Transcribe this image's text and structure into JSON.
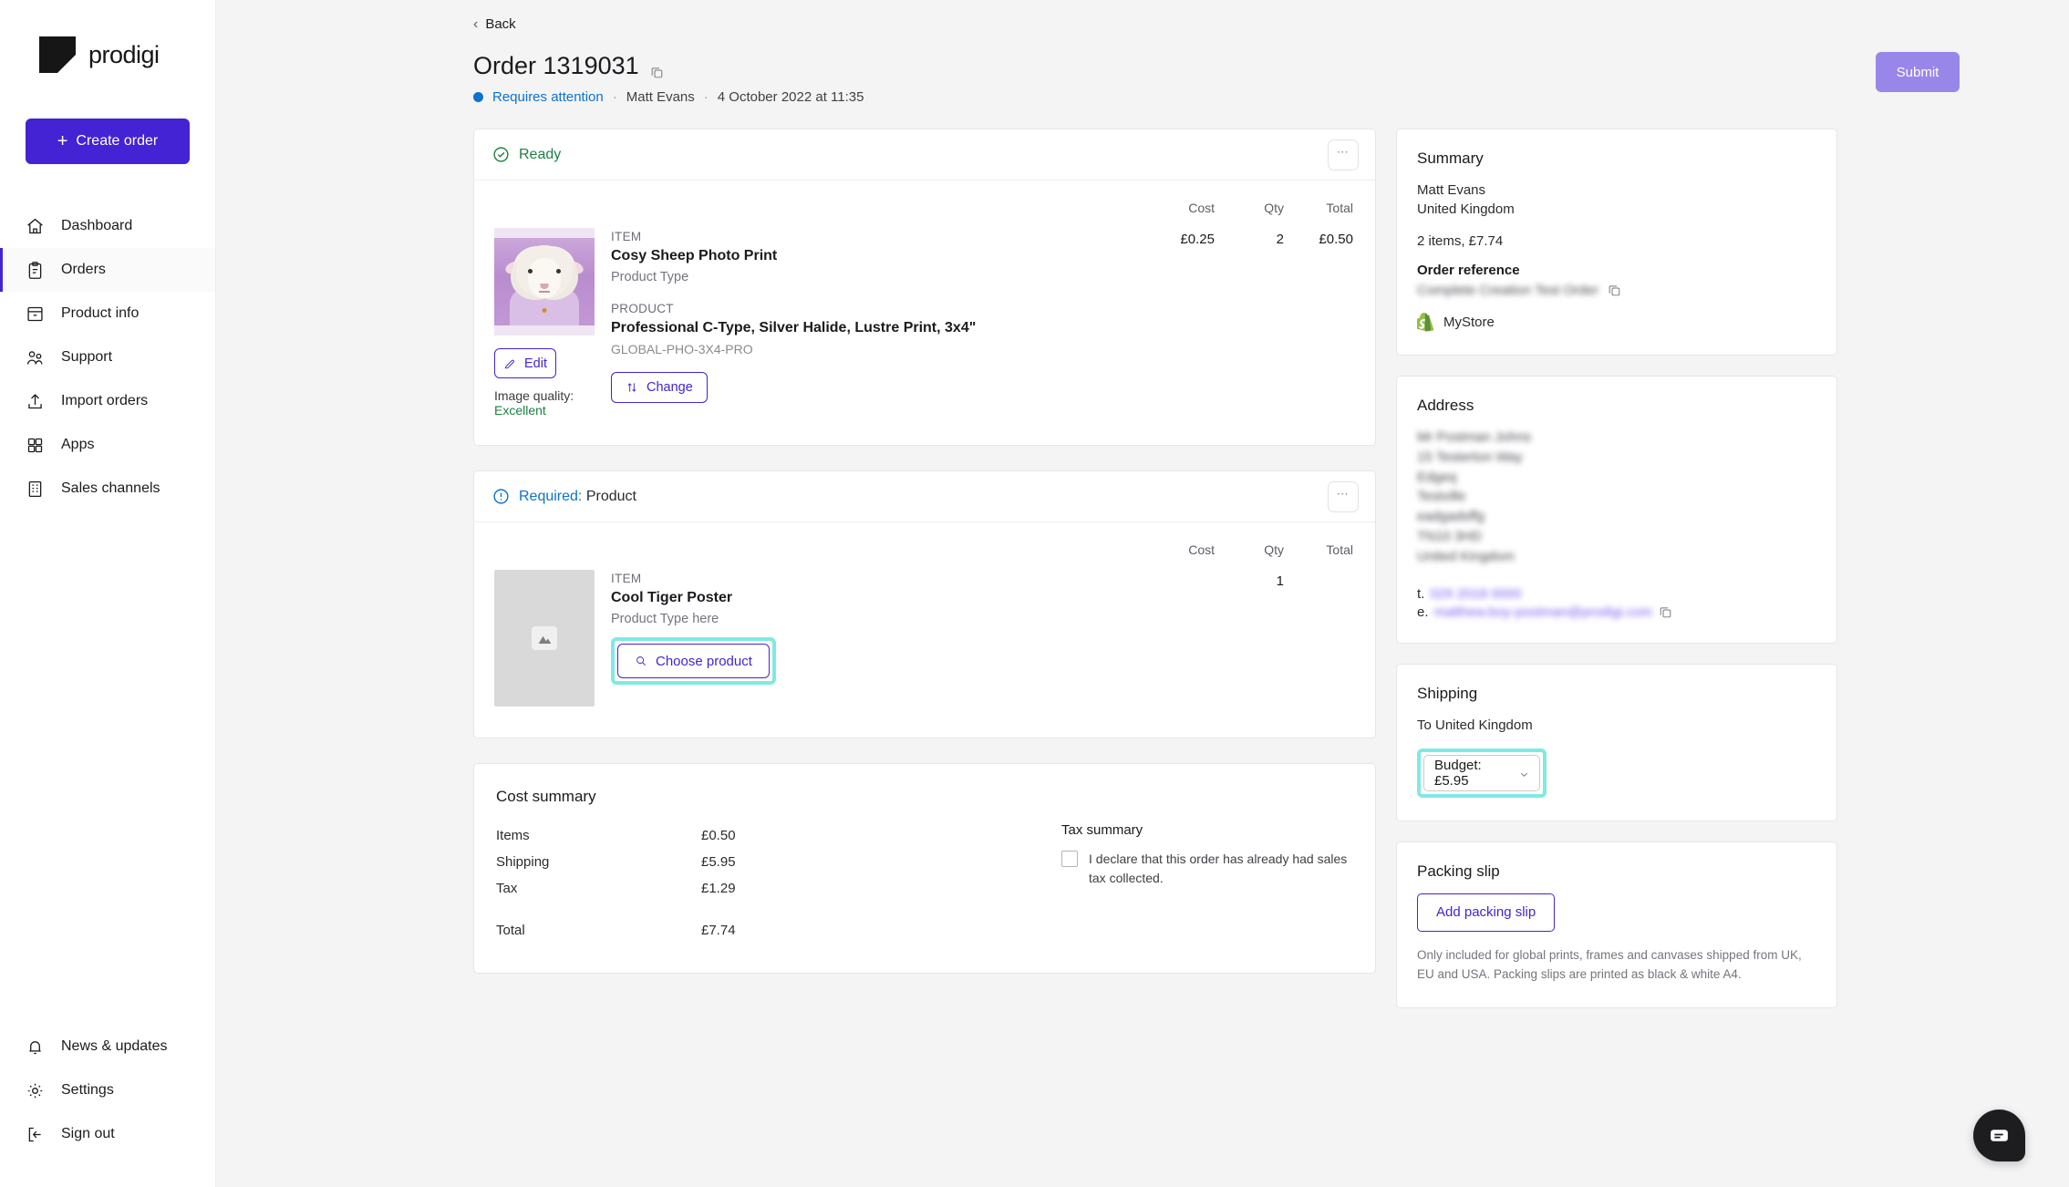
{
  "brand": {
    "name": "prodigi",
    "accent": "#4323d4"
  },
  "sidebar": {
    "create_order_label": "Create order",
    "items": [
      {
        "label": "Dashboard",
        "icon": "home-icon"
      },
      {
        "label": "Orders",
        "icon": "clipboard-icon"
      },
      {
        "label": "Product info",
        "icon": "archive-icon"
      },
      {
        "label": "Support",
        "icon": "users-icon"
      },
      {
        "label": "Import orders",
        "icon": "upload-icon"
      },
      {
        "label": "Apps",
        "icon": "grid-icon"
      },
      {
        "label": "Sales channels",
        "icon": "building-icon"
      }
    ],
    "bottom_items": [
      {
        "label": "News & updates",
        "icon": "bell-icon"
      },
      {
        "label": "Settings",
        "icon": "gear-icon"
      },
      {
        "label": "Sign out",
        "icon": "sign-out-icon"
      }
    ]
  },
  "header": {
    "back_label": "Back",
    "order_title": "Order 1319031",
    "status": "Requires attention",
    "status_color": "#0b72d0",
    "customer": "Matt Evans",
    "datetime": "4 October 2022 at 11:35",
    "separator": "·",
    "submit_label": "Submit"
  },
  "items_table": {
    "cost": "Cost",
    "qty": "Qty",
    "total": "Total"
  },
  "cards": [
    {
      "status_label": "Ready",
      "status_color": "#1e8140",
      "status_icon": "check-circle-icon",
      "item_label": "ITEM",
      "item_name": "Cosy Sheep Photo Print",
      "item_type": "Product Type",
      "product_label": "PRODUCT",
      "product_name": "Professional C-Type, Silver Halide, Lustre Print, 3x4\"",
      "sku": "GLOBAL-PHO-3X4-PRO",
      "cost": "£0.25",
      "qty": "2",
      "total": "£0.50",
      "edit_label": "Edit",
      "change_label": "Change",
      "image_quality_label": "Image quality:",
      "image_quality_value": "Excellent"
    },
    {
      "status_label_strong": "Required:",
      "status_label_rest": " Product",
      "status_color": "#0b72d0",
      "status_icon": "alert-circle-icon",
      "item_label": "ITEM",
      "item_name": "Cool Tiger Poster",
      "item_type": "Product Type here",
      "cost": "",
      "qty": "1",
      "total": "",
      "choose_label": "Choose product",
      "highlighted": true
    }
  ],
  "cost_summary": {
    "title": "Cost summary",
    "rows": [
      {
        "label": "Items",
        "value": "£0.50"
      },
      {
        "label": "Shipping",
        "value": "£5.95"
      },
      {
        "label": "Tax",
        "value": "£1.29"
      }
    ],
    "total_label": "Total",
    "total_value": "£7.74",
    "tax_title": "Tax summary",
    "tax_checkbox_label": "I declare that this order has already had sales tax collected.",
    "tax_checked": false
  },
  "summary": {
    "title": "Summary",
    "customer": "Matt Evans",
    "country": "United Kingdom",
    "items_line": "2 items, £7.74",
    "order_reference_label": "Order reference",
    "order_reference_value": "Complete Creation Test Order",
    "store_name": "MyStore",
    "store_icon": "shopify-icon"
  },
  "address": {
    "title": "Address",
    "lines": [
      "Mr Postman Johns",
      "15 Testerton Way",
      "Edgeq",
      "Testville",
      "eadgadsffg",
      "TN10 3HD",
      "United Kingdom"
    ],
    "phone_prefix": "t.",
    "phone": "029 2018 0000",
    "email_prefix": "e.",
    "email": "matthew.boy-postman@prodigi.com"
  },
  "shipping": {
    "title": "Shipping",
    "destination": "To United Kingdom",
    "selected_option": "Budget: £5.95",
    "highlighted": true
  },
  "packing_slip": {
    "title": "Packing slip",
    "button_label": "Add packing slip",
    "note": "Only included for global prints, frames and canvases shipped from UK, EU and USA. Packing slips are printed as black & white A4."
  },
  "chat": {
    "icon": "chat-bubble-icon"
  },
  "highlight_color": "#7fe9e4"
}
